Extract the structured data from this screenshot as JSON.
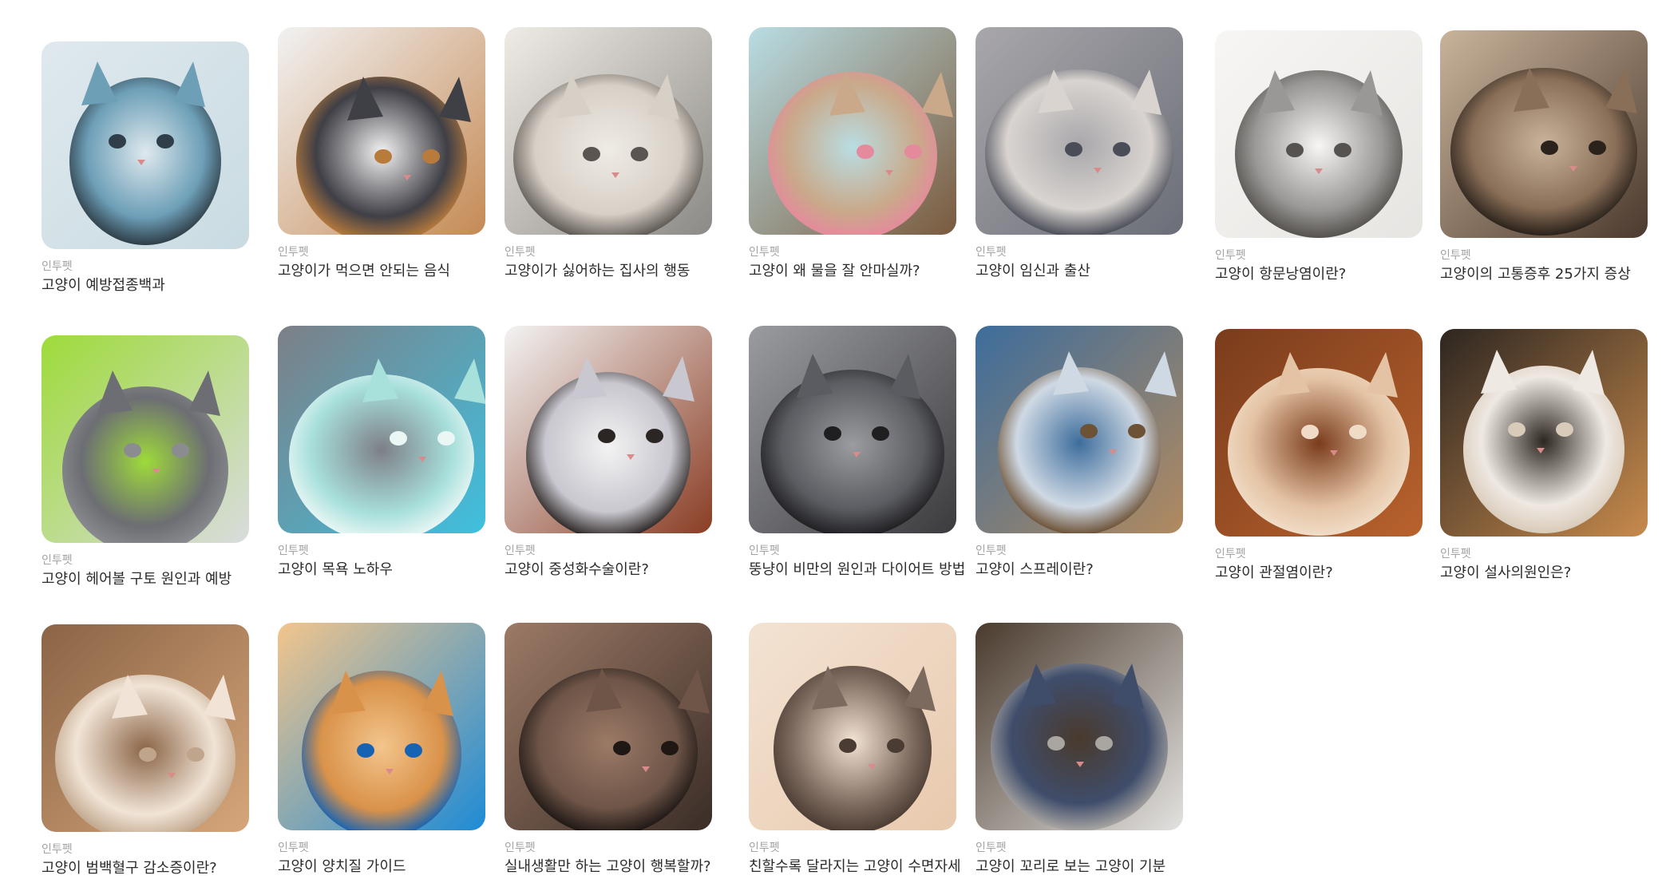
{
  "articles": [
    {
      "source": "인투펫",
      "title": "고양이 예방접종백과",
      "icon": "vaccine-vials-photo",
      "colors": [
        "#c9dbe2",
        "#6d9fb7",
        "#dfe9ee",
        "#2f3e48"
      ]
    },
    {
      "source": "인투펫",
      "title": "고양이가 먹으면 안되는 음식",
      "icon": "cat-burger-photo",
      "colors": [
        "#c58a55",
        "#3f3f46",
        "#f2f2f2",
        "#b97b3c"
      ]
    },
    {
      "source": "인투펫",
      "title": "고양이가 싫어하는 집사의 행동",
      "icon": "surprised-cat-photo",
      "colors": [
        "#8c8a86",
        "#d7d0c7",
        "#efebe5",
        "#5a5550"
      ]
    },
    {
      "source": "인투펫",
      "title": "고양이 왜 물을 잘 안마실까?",
      "icon": "cat-drinking-water-photo",
      "colors": [
        "#7a5a3d",
        "#c9a98a",
        "#b9dde3",
        "#e58a9c"
      ]
    },
    {
      "source": "인투펫",
      "title": "고양이 임신과 출산",
      "icon": "kittens-photo",
      "colors": [
        "#6b6e78",
        "#d9d4d0",
        "#a9a7ab",
        "#4a4d58"
      ]
    },
    {
      "source": "인투펫",
      "title": "고양이 항문낭염이란?",
      "icon": "white-cat-paw-photo",
      "colors": [
        "#e7e5e2",
        "#9a9896",
        "#f7f6f4",
        "#55524f"
      ]
    },
    {
      "source": "인투펫",
      "title": "고양이의 고통증후 25가지 증상",
      "icon": "tabby-cat-photo",
      "colors": [
        "#4b3a2e",
        "#8a6f58",
        "#c9b39b",
        "#2a221b"
      ]
    },
    {
      "source": "인투펫",
      "title": "고양이 헤어볼 구토 원인과 예방",
      "icon": "grey-cat-dustpan-photo",
      "colors": [
        "#d9dcdd",
        "#6c6e73",
        "#9edb3a",
        "#8a8c90"
      ]
    },
    {
      "source": "인투펫",
      "title": "고양이 목욕 노하우",
      "icon": "cat-towel-photo",
      "colors": [
        "#3fc0df",
        "#a8e0dc",
        "#7d7f86",
        "#eaf7f5"
      ]
    },
    {
      "source": "인투펫",
      "title": "고양이 중성화수술이란?",
      "icon": "cat-cone-photo",
      "colors": [
        "#8a3d24",
        "#c9c7cf",
        "#f3f3f3",
        "#2b2624"
      ]
    },
    {
      "source": "인투펫",
      "title": "뚱냥이 비만의 원인과 다이어트 방법",
      "icon": "fat-grey-cat-photo",
      "colors": [
        "#3b3b3e",
        "#5b5c61",
        "#9b9ca0",
        "#1f1f22"
      ]
    },
    {
      "source": "인투펫",
      "title": "고양이 스프레이란?",
      "icon": "cat-litter-photo",
      "colors": [
        "#b28a5f",
        "#cfd9e4",
        "#3d6d9c",
        "#6d5236"
      ]
    },
    {
      "source": "인투펫",
      "title": "고양이 관절염이란?",
      "icon": "orange-cat-stretch-photo",
      "colors": [
        "#b9622d",
        "#e4c3a4",
        "#7a3c1c",
        "#f0dcc6"
      ]
    },
    {
      "source": "인투펫",
      "title": "고양이 설사의원인은?",
      "icon": "cat-toilet-paper-photo",
      "colors": [
        "#c78a4c",
        "#efe9e3",
        "#2d2621",
        "#d9cbb9"
      ]
    },
    {
      "source": "인투펫",
      "title": "고양이 범백혈구 감소증이란?",
      "icon": "persian-cat-photo",
      "colors": [
        "#d6a67a",
        "#f1e4d6",
        "#8a6446",
        "#bfa58b"
      ]
    },
    {
      "source": "인투펫",
      "title": "고양이 양치질 가이드",
      "icon": "cat-toothbrush-photo",
      "colors": [
        "#1e8bd6",
        "#d9924a",
        "#f3c58c",
        "#1763b3"
      ]
    },
    {
      "source": "인투펫",
      "title": "실내생활만 하는 고양이 행복할까?",
      "icon": "dark-cat-photo",
      "colors": [
        "#3a2d27",
        "#6e5548",
        "#9c7a66",
        "#1e1714"
      ]
    },
    {
      "source": "인투펫",
      "title": "친할수록 달라지는 고양이 수면자세",
      "icon": "sleeping-kitten-photo",
      "colors": [
        "#e8c9ad",
        "#7d6a5e",
        "#f3e3d3",
        "#4b3c33"
      ]
    },
    {
      "source": "인투펫",
      "title": "고양이 꼬리로 보는 고양이 기분",
      "icon": "cat-tail-bag-photo",
      "colors": [
        "#e3e2e0",
        "#3f4d6b",
        "#4a3a2d",
        "#a9a6a2"
      ]
    }
  ]
}
